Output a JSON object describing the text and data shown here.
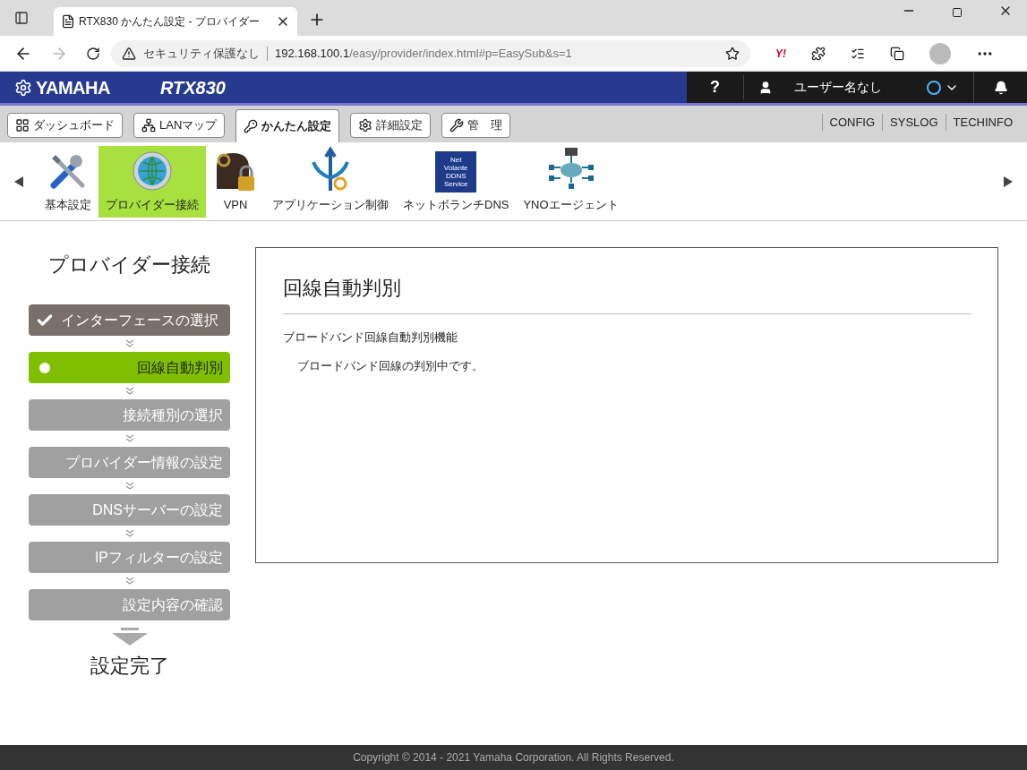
{
  "browser": {
    "tab_title": "RTX830 かんたん設定 - プロバイダー",
    "security": "セキュリティ保護なし",
    "url_host": "192.168.100.1",
    "url_path": "/easy/provider/index.html#p=EasySub&s=1",
    "yahoo_label": "Y!"
  },
  "header": {
    "brand": "YAMAHA",
    "model": "RTX830",
    "help": "?",
    "user": "ユーザー名なし"
  },
  "nav_tabs": [
    {
      "label": "ダッシュボード",
      "kind": "dashboard",
      "selected": false
    },
    {
      "label": "LANマップ",
      "kind": "lanmap",
      "selected": false
    },
    {
      "label": "かんたん設定",
      "kind": "easy",
      "selected": true
    },
    {
      "label": "詳細設定",
      "kind": "detail",
      "selected": false
    },
    {
      "label": "管　理",
      "kind": "manage",
      "selected": false
    }
  ],
  "nav_links": [
    "CONFIG",
    "SYSLOG",
    "TECHINFO"
  ],
  "feature_icons": [
    {
      "label": "基本設定",
      "kind": "tools",
      "selected": false
    },
    {
      "label": "プロバイダー接続",
      "kind": "globe",
      "selected": true
    },
    {
      "label": "VPN",
      "kind": "vpn",
      "selected": false
    },
    {
      "label": "アプリケーション制御",
      "kind": "app",
      "selected": false
    },
    {
      "label": "ネットボランチDNS",
      "kind": "ddns",
      "selected": false,
      "badge_lines": [
        "Net",
        "Volante",
        "DDNS",
        "Service"
      ]
    },
    {
      "label": "YNOエージェント",
      "kind": "yno",
      "selected": false
    }
  ],
  "wizard": {
    "title": "プロバイダー接続",
    "steps": [
      {
        "label": "インターフェースの選択",
        "completed": true,
        "selected": false
      },
      {
        "label": "回線自動判別",
        "completed": false,
        "selected": true
      },
      {
        "label": "接続種別の選択",
        "completed": false,
        "selected": false
      },
      {
        "label": "プロバイダー情報の設定",
        "completed": false,
        "selected": false
      },
      {
        "label": "DNSサーバーの設定",
        "completed": false,
        "selected": false
      },
      {
        "label": "IPフィルターの設定",
        "completed": false,
        "selected": false
      },
      {
        "label": "設定内容の確認",
        "completed": false,
        "selected": false
      }
    ],
    "finish": "設定完了"
  },
  "panel": {
    "title": "回線自動判別",
    "section_label": "ブロードバンド回線自動判別機能",
    "message": "ブロードバンド回線の判別中です。"
  },
  "footer": "Copyright © 2014 - 2021 Yamaha Corporation. All Rights Reserved."
}
